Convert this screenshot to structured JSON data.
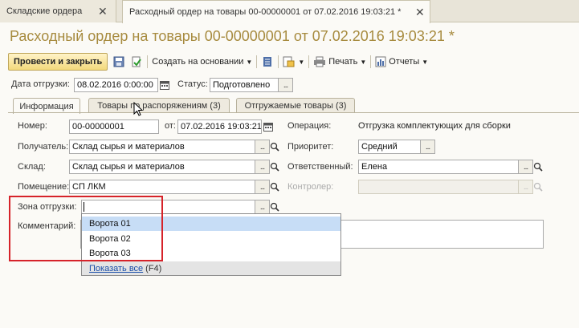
{
  "window_tabs": [
    {
      "label": "Складские ордера"
    },
    {
      "label": "Расходный ордер на товары 00-00000001 от 07.02.2016 19:03:21 *"
    }
  ],
  "title": "Расходный ордер на товары 00-00000001 от 07.02.2016 19:03:21 *",
  "toolbar": {
    "post_close": "Провести и закрыть",
    "create_based": "Создать на основании",
    "print": "Печать",
    "reports": "Отчеты"
  },
  "header": {
    "ship_date_label": "Дата отгрузки:",
    "ship_date_value": "08.02.2016  0:00:00",
    "status_label": "Статус:",
    "status_value": "Подготовлено"
  },
  "tabs": [
    {
      "label": "Информация"
    },
    {
      "label": "Товары по распоряжениям (3)"
    },
    {
      "label": "Отгружаемые товары (3)"
    }
  ],
  "form": {
    "number_label": "Номер:",
    "number_value": "00-00000001",
    "from_label": "от:",
    "from_value": "07.02.2016 19:03:21",
    "operation_label": "Операция:",
    "operation_value": "Отгрузка комплектующих для сборки",
    "recipient_label": "Получатель:",
    "recipient_value": "Склад сырья и материалов",
    "priority_label": "Приоритет:",
    "priority_value": "Средний",
    "warehouse_label": "Склад:",
    "warehouse_value": "Склад сырья и материалов",
    "responsible_label": "Ответственный:",
    "responsible_value": "Елена",
    "premises_label": "Помещение:",
    "premises_value": "СП ЛКМ",
    "controller_label": "Контролер:",
    "controller_value": "",
    "zone_label": "Зона отгрузки:",
    "zone_value": "",
    "comment_label": "Комментарий:"
  },
  "dropdown": {
    "items": [
      "Ворота 01",
      "Ворота 02",
      "Ворота 03"
    ],
    "show_all_link": "Показать все",
    "show_all_hotkey": "(F4)"
  },
  "colors": {
    "title": "#a78b3f",
    "highlight_box": "#d6232a",
    "selected_item": "#c7ddf6"
  }
}
